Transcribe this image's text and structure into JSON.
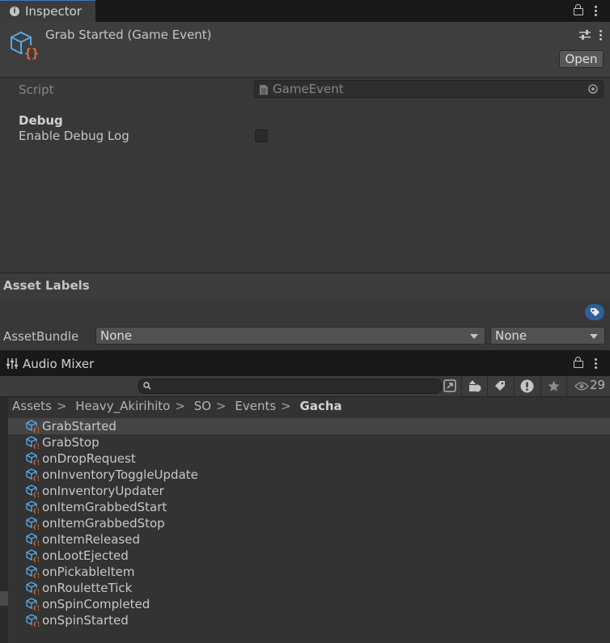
{
  "inspector_tab": {
    "label": "Inspector"
  },
  "header": {
    "title": "Grab Started (Game Event)",
    "open_label": "Open"
  },
  "fields": {
    "script_label": "Script",
    "script_value": "GameEvent",
    "debug_header": "Debug",
    "debug_label": "Enable Debug Log",
    "debug_checked": false
  },
  "asset_labels": {
    "title": "Asset Labels",
    "assetbundle_label": "AssetBundle",
    "bundle_value": "None",
    "variant_value": "None"
  },
  "mixer_tab": {
    "label": "Audio Mixer"
  },
  "toolbar": {
    "hidden_count": "29"
  },
  "breadcrumb": [
    "Assets",
    "Heavy_Akirihito",
    "SO",
    "Events",
    "Gacha"
  ],
  "files": [
    "GrabStarted",
    "GrabStop",
    "onDropRequest",
    "onInventoryToggleUpdate",
    "onInventoryUpdater",
    "onItemGrabbedStart",
    "onItemGrabbedStop",
    "onItemReleased",
    "onLootEjected",
    "onPickableItem",
    "onRouletteTick",
    "onSpinCompleted",
    "onSpinStarted"
  ],
  "colors": {
    "accent": "#3a79bb",
    "icon_cube": "#5aa8e0",
    "icon_braces": "#f0703c"
  }
}
